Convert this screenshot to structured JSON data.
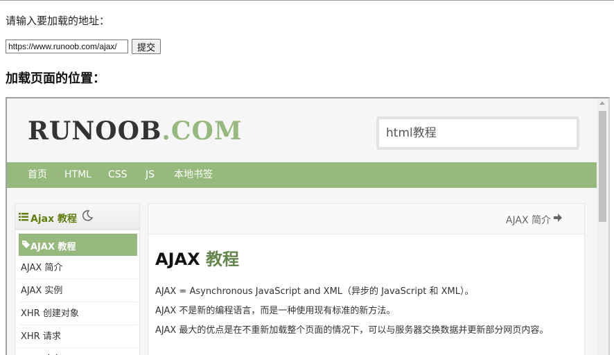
{
  "form": {
    "prompt": "请输入要加载的地址：",
    "url_value": "https://www.runoob.com/ajax/",
    "submit_label": "提交",
    "section_title": "加载页面的位置："
  },
  "site": {
    "logo_dark": "RUNOOB",
    "logo_green": ".COM",
    "search_value": "html教程",
    "nav": [
      "首页",
      "HTML",
      "CSS",
      "JS",
      "本地书签"
    ],
    "sidebar": {
      "title": "Ajax 教程",
      "active": "AJAX 教程",
      "items": [
        "AJAX 简介",
        "AJAX 实例",
        "XHR 创建对象",
        "XHR 请求",
        "XHR 响应"
      ]
    },
    "content": {
      "next_link": "AJAX 简介",
      "title_a": "AJAX",
      "title_b": "教程",
      "paragraphs": [
        "AJAX = Asynchronous JavaScript and XML（异步的 JavaScript 和 XML）。",
        "AJAX 不是新的编程语言，而是一种使用现有标准的新方法。",
        "AJAX 最大的优点是在不重新加载整个页面的情况下，可以与服务器交换数据并更新部分网页内容。"
      ]
    }
  },
  "colors": {
    "brand_green": "#96b97d",
    "title_green": "#64854c"
  }
}
